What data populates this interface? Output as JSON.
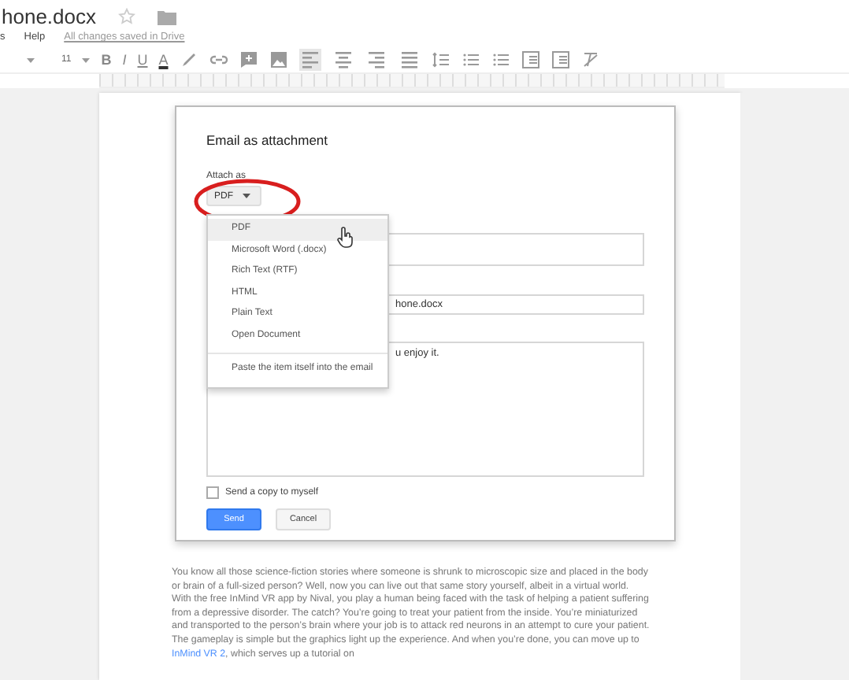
{
  "doc": {
    "title": "hone.docx",
    "menu": [
      "s",
      "Help"
    ],
    "save_status": "All changes saved in Drive"
  },
  "toolbar": [
    {
      "kind": "caret"
    },
    {
      "kind": "text",
      "label": "11"
    },
    {
      "kind": "caret"
    },
    {
      "kind": "bold",
      "label": "B"
    },
    {
      "kind": "italic",
      "label": "I"
    },
    {
      "kind": "underline",
      "label": "U"
    },
    {
      "kind": "color",
      "label": "A"
    },
    {
      "kind": "pen"
    },
    {
      "kind": "link"
    },
    {
      "kind": "comment"
    },
    {
      "kind": "image"
    },
    {
      "kind": "align-left",
      "selected": true
    },
    {
      "kind": "align-center",
      "selected": false
    },
    {
      "kind": "align-right",
      "selected": false
    },
    {
      "kind": "justify",
      "selected": false
    },
    {
      "kind": "spacing"
    },
    {
      "kind": "numbered"
    },
    {
      "kind": "bullets"
    },
    {
      "kind": "outdent"
    },
    {
      "kind": "indent"
    },
    {
      "kind": "clear"
    }
  ],
  "dialog": {
    "title": "Email as attachment",
    "attach_label": "Attach as",
    "format_button": "PDF",
    "field_value": "hone.docx",
    "message_value": "u enjoy it.",
    "dropdown": [
      {
        "label": "PDF",
        "selected": true
      },
      {
        "label": "Microsoft Word (.docx)",
        "selected": false
      },
      {
        "label": "Rich Text (RTF)",
        "selected": false
      },
      {
        "label": "HTML",
        "selected": false
      },
      {
        "label": "Plain Text",
        "selected": false
      },
      {
        "label": "Open Document",
        "selected": false
      },
      {
        "label": "Paste the item itself into the email",
        "selected": false
      }
    ],
    "copy_checkbox": {
      "label": "Send a copy to myself",
      "checked": false
    },
    "buttons": [
      {
        "label": "Send",
        "kind": "primary"
      },
      {
        "label": "Cancel",
        "kind": "secondary"
      }
    ]
  },
  "body": {
    "before_link": "You know all those science-fiction stories where someone is shrunk to microscopic size and placed in the body or brain of a full-sized person? Well, now you can live out that same story yourself, albeit in a virtual world. With the free InMind VR app by Nival, you play a human being faced with the task of helping a patient suffering from a depressive disorder. The catch? You’re going to treat your patient from the inside. You’re miniaturized and transported to the person’s brain where your job is to attack red neurons in an attempt to cure your patient. The gameplay is simple but the graphics light up the experience. And when you’re done, you can move up to ",
    "link": "InMind VR 2",
    "after_link": ", which serves up a tutorial on"
  }
}
